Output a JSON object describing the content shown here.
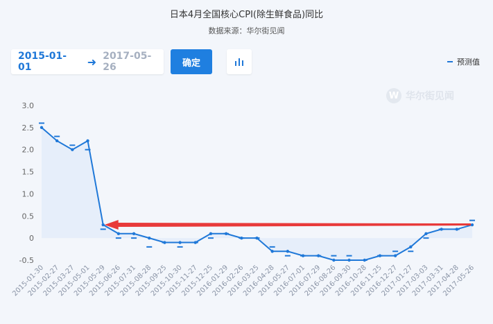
{
  "header": {
    "title": "日本4月全国核心CPI(除生鲜食品)同比",
    "subtitle": "数据来源：华尔街见闻"
  },
  "controls": {
    "start_date": "2015-01-01",
    "end_date": "2017-05-26",
    "confirm_label": "确定",
    "chart_type_icon": "bar-chart-icon"
  },
  "legend": {
    "label": "预测值"
  },
  "watermark": {
    "text": "华尔街见闻",
    "logo_letter": "W"
  },
  "colors": {
    "line": "#1f78d8",
    "area": "#e3ecf9",
    "arrow": "#e83a3a",
    "button": "#1f7fe0"
  },
  "chart_data": {
    "type": "line",
    "categories": [
      "2015-01-30",
      "2015-02-27",
      "2015-03-27",
      "2015-05-01",
      "2015-05-29",
      "2015-06-26",
      "2015-07-31",
      "2015-08-28",
      "2015-09-25",
      "2015-10-30",
      "2015-11-27",
      "2015-12-25",
      "2016-01-29",
      "2016-02-26",
      "2016-03-25",
      "2016-04-28",
      "2016-05-27",
      "2016-07-01",
      "2016-07-29",
      "2016-08-26",
      "2016-09-30",
      "2016-10-28",
      "2016-11-25",
      "2016-12-27",
      "2017-01-27",
      "2017-03-03",
      "2017-03-31",
      "2017-04-28",
      "2017-05-26"
    ],
    "series": [
      {
        "values": [
          2.5,
          2.2,
          2.0,
          2.2,
          0.3,
          0.1,
          0.1,
          0.0,
          -0.1,
          -0.1,
          -0.1,
          0.1,
          0.1,
          0.0,
          0.0,
          -0.3,
          -0.3,
          -0.4,
          -0.4,
          -0.5,
          -0.5,
          -0.5,
          -0.4,
          -0.4,
          -0.2,
          0.1,
          0.2,
          0.2,
          0.3
        ]
      },
      {
        "name": "预测值",
        "values": [
          2.6,
          2.3,
          2.1,
          2.0,
          0.2,
          0.0,
          0.0,
          -0.2,
          -0.1,
          -0.2,
          -0.1,
          0.0,
          0.1,
          0.0,
          0.0,
          -0.2,
          -0.4,
          -0.4,
          -0.4,
          -0.4,
          -0.4,
          -0.5,
          -0.4,
          -0.3,
          -0.3,
          0.0,
          0.2,
          0.2,
          0.4
        ]
      }
    ],
    "yticks": [
      "3.0",
      "2.5",
      "2.0",
      "1.5",
      "1.0",
      "0.5",
      "0",
      "-0.5"
    ],
    "ylim": [
      -0.5,
      3.0
    ],
    "grid": false,
    "legend_position": "top-right",
    "annotation": {
      "type": "arrow",
      "from_index": 28,
      "to_index": 4
    }
  }
}
